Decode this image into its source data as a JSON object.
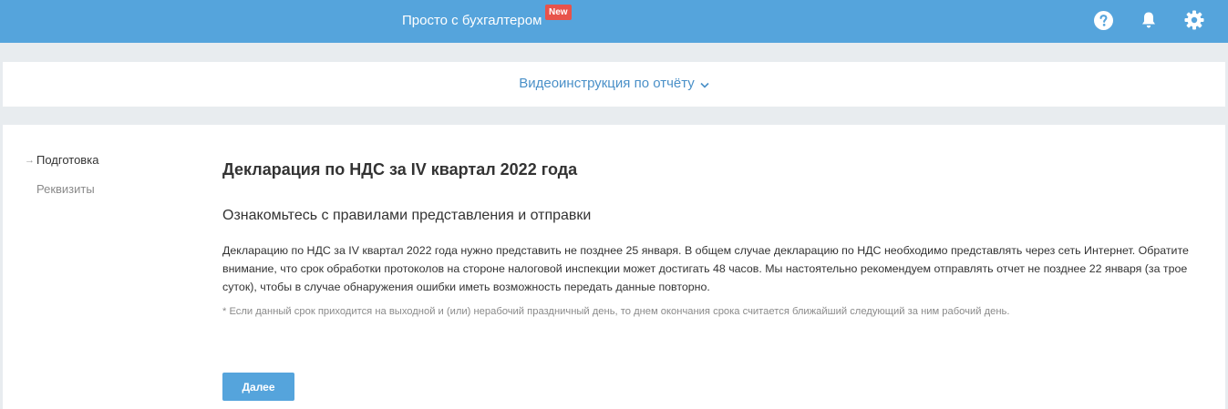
{
  "header": {
    "brand_label": "Просто с бухгалтером",
    "new_badge": "New",
    "icons": [
      "help-icon",
      "bell-icon",
      "gear-icon"
    ],
    "bg_color": "#55a4dc"
  },
  "video_panel": {
    "link_label": "Видеоинструкция по отчёту"
  },
  "steps": [
    {
      "label": "Подготовка",
      "active": true
    },
    {
      "label": "Реквизиты",
      "active": false
    }
  ],
  "main": {
    "title": "Декларация по НДС за IV квартал 2022 года",
    "subtitle": "Ознакомьтесь с правилами представления и отправки",
    "paragraph": "Декларацию по НДС за IV квартал 2022 года нужно представить не позднее 25 января. В общем случае декларацию по НДС необходимо представлять через сеть Интернет. Обратите внимание, что срок обработки протоколов на стороне налоговой инспекции может достигать 48 часов. Мы настоятельно рекомендуем отправлять отчет не позднее 22 января (за трое суток), чтобы в случае обнаружения ошибки иметь возможность передать данные повторно.",
    "note": "* Если данный срок приходится на выходной и (или) нерабочий праздничный день, то днем окончания срока считается ближайший следующий за ним рабочий день.",
    "next_button_label": "Далее"
  },
  "colors": {
    "accent": "#55a4dc",
    "badge": "#e8534a",
    "link": "#4a90c8"
  }
}
